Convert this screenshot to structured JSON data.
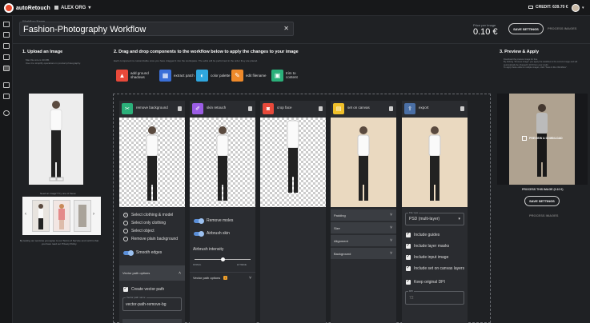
{
  "topbar": {
    "logo_text": "autoRetouch",
    "org": "ALEX ORG",
    "credit": "CREDIT: 639.70 €"
  },
  "workflow": {
    "name_label": "Workflow Name",
    "name_value": "Fashion-Photography Workflow",
    "price_label": "Price per Image",
    "price": "0.10 €",
    "save_settings": "SAVE SETTINGS",
    "process_images": "PROCESS IMAGES"
  },
  "steps": {
    "upload": "1. Upload an Image",
    "upload_note": "Max file size is 30 MB.\nUse it to simplify operations in product photography.",
    "drag": "2. Drag and drop components to the workflow below to apply the changes to your image",
    "drag_note": "Each component is customizable once you have dragged it into the workspace. The edits will be performed in the order they are placed.",
    "preview": "3. Preview & Apply",
    "preview_note": "Download the preview image for free.\nBy clicking \"Process Image\" you apply the workflow to the current image and will automatically be charged 0.10 € from your credit.\nTo apply these edits to multiple images, click \"Save & Run Workflow\"."
  },
  "palette": [
    {
      "label": "add ground shadows",
      "color": "#e8493a",
      "glyph": "▲"
    },
    {
      "label": "extract patch",
      "color": "#3a6fd8",
      "glyph": "▦"
    },
    {
      "label": "color palette",
      "color": "#2fa7df",
      "glyph": "◐"
    },
    {
      "label": "edit filename",
      "color": "#f08a2a",
      "glyph": "✎"
    },
    {
      "label": "trim to content",
      "color": "#2bb07a",
      "glyph": "▣"
    }
  ],
  "upload_panel": {
    "need_text": "Need an image? Try one of these:",
    "terms": "By testing our services you agree to our Terms of Service and confirm that you have read our Privacy Policy."
  },
  "cards": [
    {
      "title": "remove background",
      "color": "#2bb07a",
      "glyph": "✂"
    },
    {
      "title": "skin retouch",
      "color": "#9b5de5",
      "glyph": "✐"
    },
    {
      "title": "crop face",
      "color": "#e8493a",
      "glyph": "◙"
    },
    {
      "title": "set on canvas",
      "color": "#f0c02a",
      "glyph": "▤"
    },
    {
      "title": "export",
      "color": "#4a6fa5",
      "glyph": "⇪"
    }
  ],
  "remove_bg": {
    "options": [
      "Select clothing & model",
      "Select only clothing",
      "Select object",
      "Remove plain background"
    ],
    "selected_index": 0,
    "smooth_edges": "Smooth edges",
    "vector_path_options": "Vector path options",
    "create_vector_path": "Create vector path",
    "vector_path_name_label": "Vector path name",
    "vector_path_name": "vector-path-remove-bg"
  },
  "skin": {
    "remove_moles": "Remove moles",
    "airbrush_skin": "Airbrush skin",
    "airbrush_intensity": "Airbrush intensity",
    "slider_min": "MINIMAL",
    "slider_max": "EXTREME",
    "intensity_fraction": 0.5,
    "vector_path_options": "Vector path options",
    "vector_badge": "!"
  },
  "canvas": {
    "accordions": [
      "Padding",
      "Size",
      "Alignment",
      "Background"
    ]
  },
  "export": {
    "file_type_label": "File type",
    "file_type": "PSD (multi-layer)",
    "checks": [
      {
        "label": "Include guides",
        "on": true
      },
      {
        "label": "Include layer masks",
        "on": true
      },
      {
        "label": "Include input image",
        "on": true
      },
      {
        "label": "Include set on canvas layers",
        "on": true
      },
      {
        "label": "Keep original DPI",
        "on": true
      }
    ],
    "dpi_label": "DPI",
    "dpi_placeholder": "72"
  },
  "preview": {
    "overlay_text": "PREVIEW & DOWNLOAD",
    "process_this": "PROCESS THIS IMAGE (0.10 €)",
    "save_settings": "SAVE SETTINGS",
    "process_images": "PROCESS IMAGES"
  }
}
